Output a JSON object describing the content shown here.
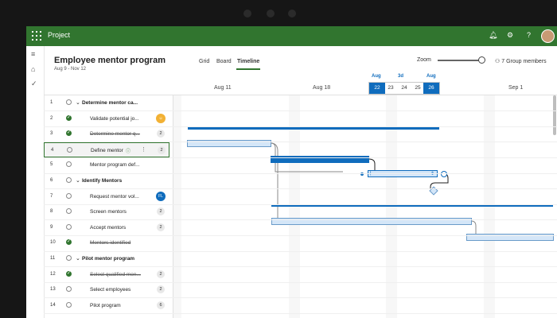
{
  "app": {
    "name": "Project"
  },
  "topbar": {
    "icons": [
      "bell-icon",
      "gear-icon",
      "help-icon"
    ]
  },
  "rail": {
    "icons": [
      "hamburger-icon",
      "home-icon",
      "check-icon"
    ]
  },
  "plan": {
    "title": "Employee mentor program",
    "dates": "Aug 9 - Nov 12"
  },
  "views": {
    "grid": "Grid",
    "board": "Board",
    "timeline": "Timeline",
    "active": "Timeline"
  },
  "zoom": {
    "label": "Zoom",
    "level": 0.92
  },
  "members": {
    "label": "7 Group members"
  },
  "timeline": {
    "week_labels": {
      "aug11": "Aug 11",
      "aug18": "Aug 18",
      "sep1": "Sep 1"
    },
    "month_labels": {
      "left": "Aug",
      "mid": "3d",
      "right": "Aug"
    },
    "days": [
      "22",
      "23",
      "24",
      "25",
      "26"
    ],
    "selected_days": [
      "22",
      "26"
    ]
  },
  "tasks": [
    {
      "num": "1",
      "name": "Determine mentor ca...",
      "summary": true,
      "done": false
    },
    {
      "num": "2",
      "name": "Validate potential jo...",
      "done": true,
      "avatar": true
    },
    {
      "num": "3",
      "name": "Determine mentor q...",
      "done": true,
      "struck": true,
      "count": "2"
    },
    {
      "num": "4",
      "name": "Define mentor",
      "done": false,
      "count": "2",
      "selected": true
    },
    {
      "num": "5",
      "name": "Mentor program def...",
      "done": false
    },
    {
      "num": "6",
      "name": "Identify Mentors",
      "summary": true,
      "done": false
    },
    {
      "num": "7",
      "name": "Request mentor vol...",
      "done": false,
      "initials": "FL"
    },
    {
      "num": "8",
      "name": "Screen mentors",
      "done": false,
      "count": "2"
    },
    {
      "num": "9",
      "name": "Accept mentors",
      "done": false,
      "count": "2"
    },
    {
      "num": "10",
      "name": "Mentors identified",
      "done": true,
      "struck": true
    },
    {
      "num": "11",
      "name": "Pilot mentor program",
      "summary": true,
      "done": false
    },
    {
      "num": "12",
      "name": "Select qualified men...",
      "done": true,
      "struck": true,
      "count": "2"
    },
    {
      "num": "13",
      "name": "Select employees",
      "done": false,
      "count": "2"
    },
    {
      "num": "14",
      "name": "Pilot program",
      "done": false,
      "count": "6"
    }
  ],
  "colors": {
    "brand": "#31752f",
    "accent": "#0f6cbd",
    "bar_light": "#d4e6f8"
  }
}
